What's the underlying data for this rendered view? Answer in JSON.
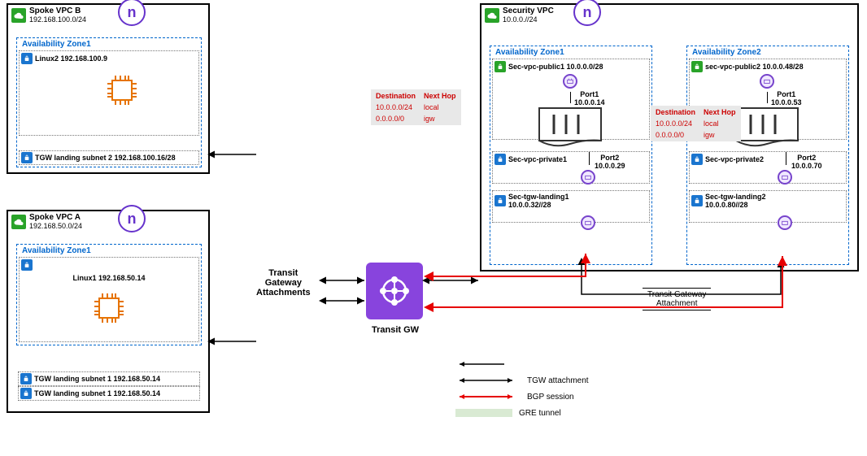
{
  "spokeB": {
    "title": "Spoke VPC B",
    "cidr": "192.168.100.0/24",
    "az1": {
      "label": "Availability Zone1",
      "linux": "Linux2  192.168.100.9",
      "tgw_subnet": "TGW landing subnet 2 192.168.100.16/28"
    }
  },
  "spokeA": {
    "title": "Spoke VPC A",
    "cidr": "192.168.50.0/24",
    "az1": {
      "label": "Availability Zone1",
      "linux": "Linux1  192.168.50.14",
      "tgw_subnet1": "TGW landing subnet 1 192.168.50.14",
      "tgw_subnet2": "TGW landing subnet 1 192.168.50.14"
    }
  },
  "security": {
    "title": "Security VPC",
    "cidr": "10.0.0.//24",
    "az1": {
      "label": "Availability Zone1",
      "public": "Sec-vpc-public1  10.0.0.0/28",
      "private": "Sec-vpc-private1",
      "private_port2_ip": "10.0.0.29",
      "port1_label": "Port1",
      "port1_ip": "10.0.0.14",
      "port2_label": "Port2",
      "landing": "Sec-tgw-landing1",
      "landing_cidr": "10.0.0.32//28"
    },
    "az2": {
      "label": "Availability Zone2",
      "public": "sec-vpc-public2  10.0.0.48/28",
      "private": "Sec-vpc-private2",
      "private_port2_ip": "10.0.0.70",
      "port1_label": "Port1",
      "port1_ip": "10.0.0.53",
      "port2_label": "Port2",
      "landing": "Sec-tgw-landing2",
      "landing_cidr": "10.0.0.80//28"
    }
  },
  "routeTable1": {
    "hDest": "Destination",
    "hNext": "Next Hop",
    "r1d": "10.0.0.0/24",
    "r1n": "local",
    "r2d": "0.0.0.0/0",
    "r2n": "igw"
  },
  "routeTable2": {
    "hDest": "Destination",
    "hNext": "Next Hop",
    "r1d": "10.0.0.0/24",
    "r1n": "local",
    "r2d": "0.0.0.0/0",
    "r2n": "igw"
  },
  "tga_label": "Transit\nGateway\nAttachments",
  "tgw_label": "Transit GW",
  "tga2_label": "Transit Gateway\nAttachment",
  "legend": {
    "tgw": "TGW attachment",
    "bgp": "BGP session",
    "gre": "GRE tunnel"
  }
}
